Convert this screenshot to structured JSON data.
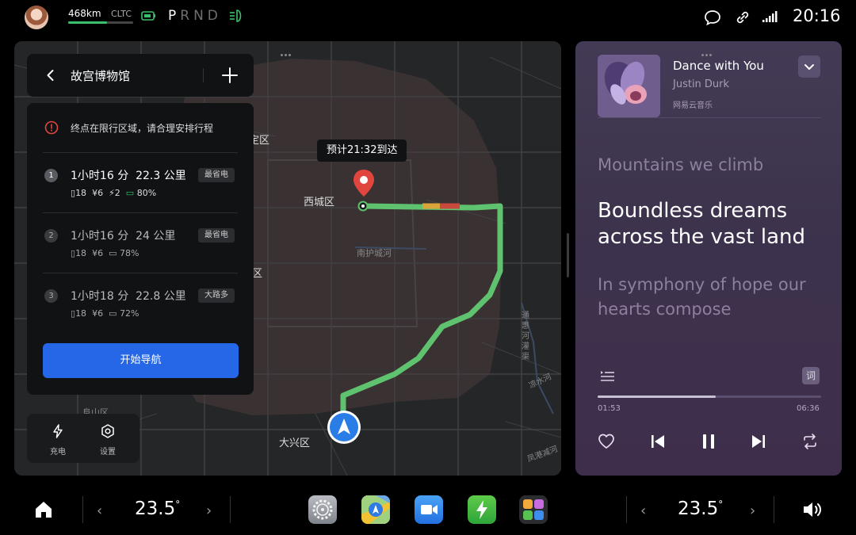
{
  "status_bar": {
    "range": "468km",
    "range_standard": "CLTC",
    "range_fraction": 0.6,
    "gears": [
      "P",
      "R",
      "N",
      "D"
    ],
    "active_gear": "P",
    "time": "20:16"
  },
  "map": {
    "eta_label": "预计21:32到达",
    "district_labels": [
      "西城区",
      "大兴区"
    ],
    "road_labels": [
      "南护城河"
    ],
    "partial_labels": {
      "west_top": "定区",
      "west_mid": "区",
      "southwest": "阜山区",
      "east_river_1": "通惠河灌渠",
      "east_river_2": "凉水河",
      "southeast": "凤港减河"
    }
  },
  "route_panel": {
    "destination": "故宫博物馆",
    "warning": "终点在限行区域，请合理安排行程",
    "routes": [
      {
        "num": "1",
        "duration_h": "1",
        "duration_m": "16",
        "distance": "22.3",
        "tag": "最省电",
        "traffic_lights": "18",
        "cost": "6",
        "chargers": "2",
        "battery": "80%",
        "selected": true
      },
      {
        "num": "2",
        "duration_h": "1",
        "duration_m": "16",
        "distance": "24",
        "tag": "最省电",
        "traffic_lights": "18",
        "cost": "6",
        "battery": "78%",
        "selected": false
      },
      {
        "num": "3",
        "duration_h": "1",
        "duration_m": "18",
        "distance": "22.8",
        "tag": "大路多",
        "traffic_lights": "18",
        "cost": "6",
        "battery": "72%",
        "selected": false
      }
    ],
    "start_button": "开始导航",
    "hour_unit": "小时",
    "minute_unit": "分",
    "distance_unit": "公里",
    "currency": "¥"
  },
  "map_tools": {
    "charge_label": "充电",
    "settings_label": "设置"
  },
  "music": {
    "title": "Dance with You",
    "artist": "Justin Durk",
    "source": "网易云音乐",
    "lyric_prev": "Mountains we climb",
    "lyric_current": "Boundless dreams across the vast land",
    "lyric_next": "In symphony of hope our hearts compose",
    "lyric_button": "词",
    "time_current": "01:53",
    "time_total": "06:36",
    "progress_fraction": 0.53
  },
  "dock": {
    "temp_left": "23.5",
    "temp_right": "23.5",
    "degree": "°",
    "apps": [
      "settings-app",
      "maps-app",
      "video-call-app",
      "charging-app",
      "control-center-app"
    ]
  },
  "colors": {
    "accent_blue": "#2667e8",
    "route_green": "#5fc26e",
    "traffic_yellow": "#d9a43a",
    "traffic_red": "#c94a3d",
    "pin_red": "#e0463e"
  }
}
